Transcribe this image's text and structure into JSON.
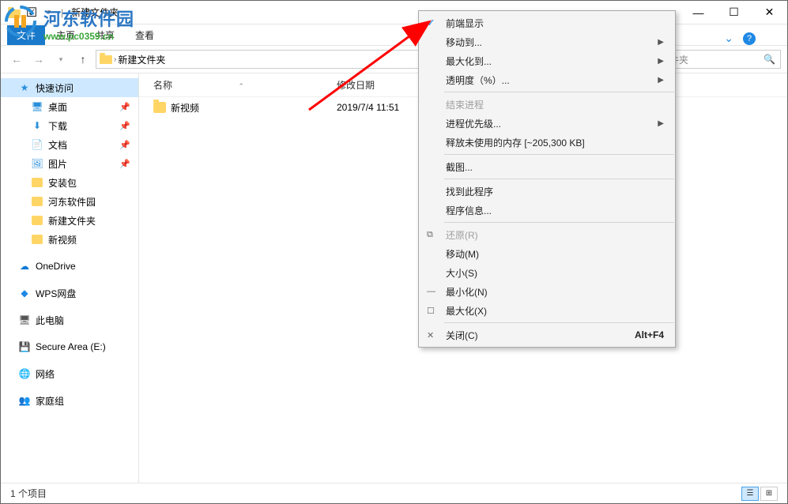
{
  "window": {
    "title": "新建文件夹",
    "sep": "|"
  },
  "ribbon": {
    "file": "文件",
    "tabs": [
      "主页",
      "共享",
      "查看"
    ]
  },
  "address": {
    "root_icon": "folder",
    "crumbs": [
      "新建文件夹"
    ],
    "search_placeholder": "文件夹"
  },
  "nav": {
    "quick_access": "快速访问",
    "items_pinned": [
      {
        "label": "桌面",
        "icon": "desktop"
      },
      {
        "label": "下载",
        "icon": "download"
      },
      {
        "label": "文档",
        "icon": "doc"
      },
      {
        "label": "图片",
        "icon": "pic"
      }
    ],
    "items_folders": [
      "安装包",
      "河东软件园",
      "新建文件夹",
      "新视频"
    ],
    "onedrive": "OneDrive",
    "wps": "WPS网盘",
    "this_pc": "此电脑",
    "secure_area": "Secure Area (E:)",
    "network": "网络",
    "homegroup": "家庭组"
  },
  "columns": {
    "name": "名称",
    "date": "修改日期"
  },
  "files": [
    {
      "name": "新视频",
      "date": "2019/7/4 11:51"
    }
  ],
  "statusbar": {
    "count": "1 个项目"
  },
  "context_menu": {
    "front": "前端显示",
    "move_to": "移动到...",
    "maximize_to": "最大化到...",
    "opacity": "透明度（%）...",
    "end_process": "结束进程",
    "priority": "进程优先级...",
    "release_mem": "释放未使用的内存 [~205,300 KB]",
    "screenshot": "截图...",
    "find_program": "找到此程序",
    "program_info": "程序信息...",
    "restore": "还原(R)",
    "move": "移动(M)",
    "size": "大小(S)",
    "minimize": "最小化(N)",
    "maximize": "最大化(X)",
    "close": "关闭(C)",
    "close_shortcut": "Alt+F4"
  },
  "watermark": {
    "title": "河东软件园",
    "url": "www.pc0359.cn"
  }
}
